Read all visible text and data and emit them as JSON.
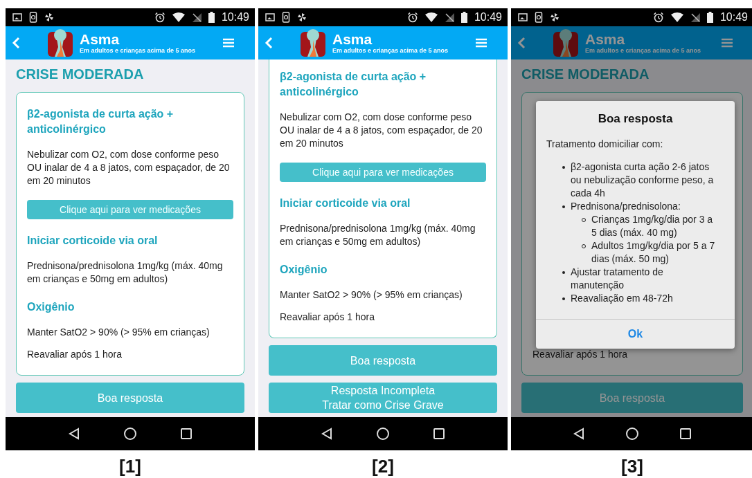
{
  "screens": [
    {
      "label": "[1]",
      "status_bar": {
        "time": "10:49"
      },
      "header": {
        "title": "Asma",
        "subtitle": "Em adultos e crianças acima de 5 anos"
      },
      "section_title": "CRISE MODERADA",
      "card": {
        "top_visible": true,
        "blocks": [
          {
            "kind": "heading",
            "text": "β2-agonista de curta ação + anticolinérgico"
          },
          {
            "kind": "text",
            "text": "Nebulizar com O2, com dose conforme peso OU inalar de 4 a 8 jatos, com espaçador, de 20 em 20 minutos"
          },
          {
            "kind": "link_button",
            "text": "Clique aqui para ver medicações"
          },
          {
            "kind": "heading",
            "text": "Iniciar corticoide via oral"
          },
          {
            "kind": "text",
            "text": "Prednisona/prednisolona 1mg/kg (máx. 40mg em crianças e 50mg em adultos)"
          },
          {
            "kind": "heading",
            "text": "Oxigênio"
          },
          {
            "kind": "text",
            "text": "Manter SatO2 > 90% (> 95% em crianças)"
          },
          {
            "kind": "text",
            "text": "Reavaliar após 1 hora"
          }
        ]
      },
      "buttons": [
        "Boa resposta"
      ]
    },
    {
      "label": "[2]",
      "status_bar": {
        "time": "10:49"
      },
      "header": {
        "title": "Asma",
        "subtitle": "Em adultos e crianças acima de 5 anos"
      },
      "card": {
        "top_visible": false,
        "blocks": [
          {
            "kind": "heading",
            "text": "β2-agonista de curta ação + anticolinérgico"
          },
          {
            "kind": "text",
            "text": "Nebulizar com O2, com dose conforme peso OU inalar de 4 a 8 jatos, com espaçador, de 20 em 20 minutos"
          },
          {
            "kind": "link_button",
            "text": "Clique aqui para ver medicações"
          },
          {
            "kind": "heading",
            "text": "Iniciar corticoide via oral"
          },
          {
            "kind": "text",
            "text": "Prednisona/prednisolona 1mg/kg (máx. 40mg em crianças e 50mg em adultos)"
          },
          {
            "kind": "heading",
            "text": "Oxigênio"
          },
          {
            "kind": "text",
            "text": "Manter SatO2 > 90% (> 95% em crianças)"
          },
          {
            "kind": "text",
            "text": "Reavaliar após 1 hora"
          }
        ]
      },
      "buttons": [
        "Boa resposta",
        "Resposta Incompleta\nTratar como Crise Grave"
      ]
    },
    {
      "label": "[3]",
      "status_bar": {
        "time": "10:49"
      },
      "header": {
        "title": "Asma",
        "subtitle": "Em adultos e crianças acima de 5 anos"
      },
      "section_title": "CRISE MODERADA",
      "card": {
        "top_visible": true,
        "blocks": [
          {
            "kind": "text",
            "text": "Reavaliar após 1 hora"
          }
        ]
      },
      "buttons": [
        "Boa resposta"
      ],
      "dialog": {
        "title": "Boa resposta",
        "intro": "Tratamento domiciliar com:",
        "items": [
          {
            "text": "β2-agonista curta ação 2-6 jatos ou nebulização conforme peso, a cada 4h"
          },
          {
            "text": "Prednisona/prednisolona:",
            "children": [
              {
                "text": "Crianças 1mg/kg/dia por 3 a 5 dias (máx. 40 mg)"
              },
              {
                "text": "Adultos 1mg/kg/dia por 5 a 7 dias (máx. 50 mg)"
              }
            ]
          },
          {
            "text": "Ajustar tratamento de manutenção"
          },
          {
            "text": "Reavaliação em 48-72h"
          }
        ],
        "button": "Ok"
      }
    }
  ]
}
